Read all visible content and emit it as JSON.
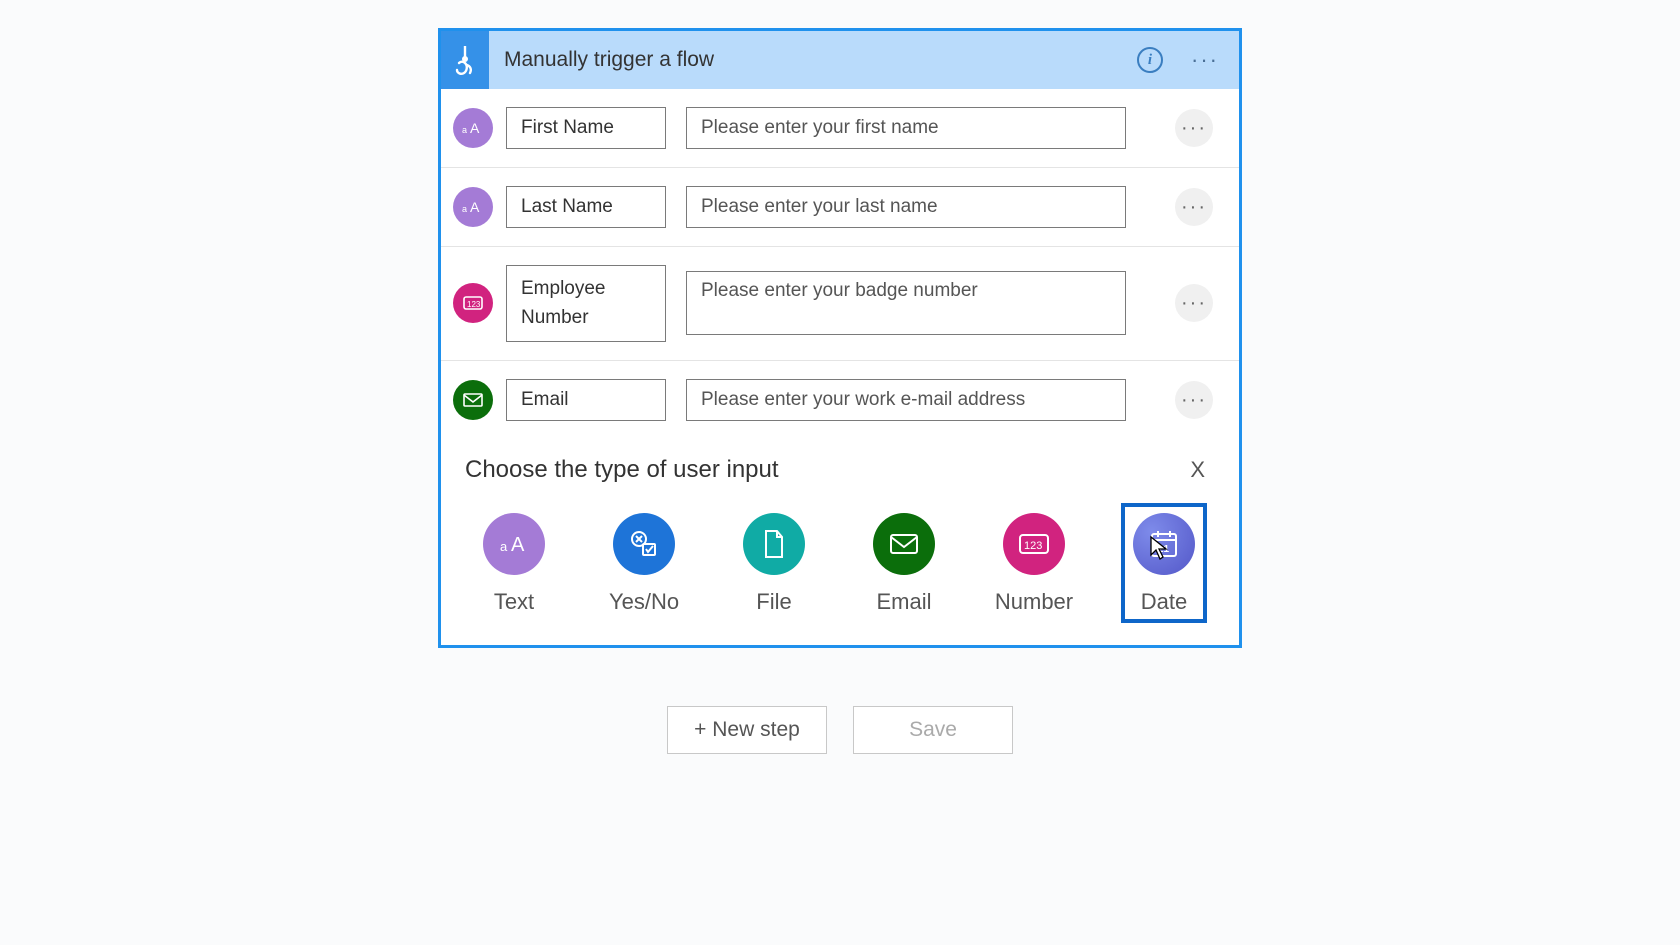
{
  "header": {
    "title": "Manually trigger a flow"
  },
  "inputs": [
    {
      "name": "First Name",
      "desc": "Please enter your first name",
      "type": "text"
    },
    {
      "name": "Last Name",
      "desc": "Please enter your last name",
      "type": "text"
    },
    {
      "name": "Employee Number",
      "desc": "Please enter your badge number",
      "type": "number"
    },
    {
      "name": "Email",
      "desc": "Please enter your work e-mail address",
      "type": "email"
    }
  ],
  "picker": {
    "title": "Choose the type of user input",
    "close": "X",
    "options": [
      {
        "id": "text",
        "label": "Text"
      },
      {
        "id": "yesno",
        "label": "Yes/No"
      },
      {
        "id": "file",
        "label": "File"
      },
      {
        "id": "email",
        "label": "Email"
      },
      {
        "id": "number",
        "label": "Number"
      },
      {
        "id": "date",
        "label": "Date"
      }
    ],
    "selected": "date"
  },
  "footer": {
    "new_step": "+ New step",
    "save": "Save"
  }
}
